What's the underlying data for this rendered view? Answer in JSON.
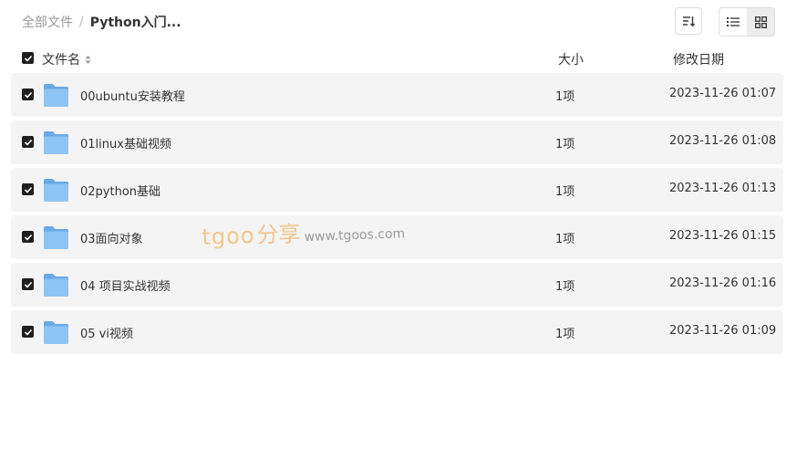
{
  "breadcrumb": {
    "root": "全部文件",
    "separator": "/",
    "current": "Python入门..."
  },
  "toolbar": {
    "sort_icon": "sort-lines-icon",
    "list_view_icon": "list-view-icon",
    "grid_view_icon": "grid-view-icon"
  },
  "table": {
    "headers": {
      "name": "文件名",
      "size": "大小",
      "date": "修改日期"
    },
    "rows": [
      {
        "name": "00ubuntu安装教程",
        "size": "1项",
        "date": "2023-11-26 01:07"
      },
      {
        "name": "01linux基础视频",
        "size": "1项",
        "date": "2023-11-26 01:08"
      },
      {
        "name": "02python基础",
        "size": "1项",
        "date": "2023-11-26 01:13"
      },
      {
        "name": "03面向对象",
        "size": "1项",
        "date": "2023-11-26 01:15"
      },
      {
        "name": "04 项目实战视频",
        "size": "1项",
        "date": "2023-11-26 01:16"
      },
      {
        "name": "05 vi视频",
        "size": "1项",
        "date": "2023-11-26 01:09"
      }
    ]
  },
  "watermark": {
    "brand": "tgoo",
    "share": "分享",
    "url": "www.tgoos.com"
  },
  "colors": {
    "row_bg": "#f4f4f4",
    "checkbox": "#1f1f1f",
    "folder": "#7fb8ee",
    "watermark": "#f3c58f"
  }
}
